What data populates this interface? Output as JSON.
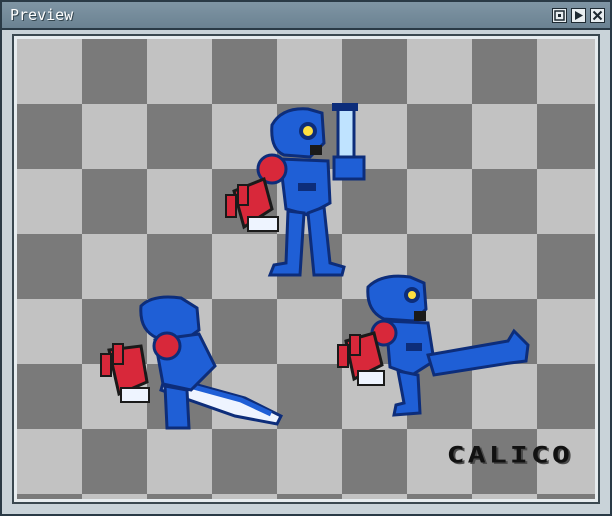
{
  "window": {
    "title": "Preview",
    "buttons": [
      {
        "name": "fit-icon"
      },
      {
        "name": "play-icon"
      },
      {
        "name": "close-icon"
      }
    ]
  },
  "canvas": {
    "checker_colors": [
      "#7a7a7a",
      "#c2c2c2"
    ],
    "logo_text": "CALICO"
  },
  "sprite_colors": {
    "armor_blue": "#1f5fd6",
    "armor_dark": "#0d2d7a",
    "claw_red": "#d8283a",
    "visor_yellow": "#ffe040",
    "blade_white": "#eef4ff"
  }
}
